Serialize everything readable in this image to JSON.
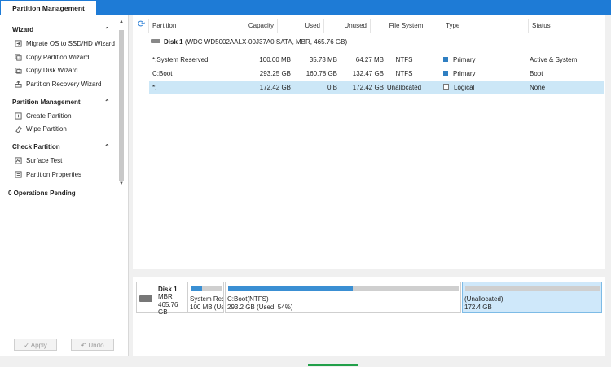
{
  "tab": {
    "label": "Partition Management"
  },
  "sidebar": {
    "sections": [
      {
        "title": "Wizard",
        "items": [
          "Migrate OS to SSD/HD Wizard",
          "Copy Partition Wizard",
          "Copy Disk Wizard",
          "Partition Recovery Wizard"
        ]
      },
      {
        "title": "Partition Management",
        "items": [
          "Create Partition",
          "Wipe Partition"
        ]
      },
      {
        "title": "Check Partition",
        "items": [
          "Surface Test",
          "Partition Properties"
        ]
      }
    ],
    "ops_pending": "0 Operations Pending",
    "apply_label": "✓ Apply",
    "undo_label": "↶ Undo"
  },
  "table": {
    "headers": [
      "Partition",
      "Capacity",
      "Used",
      "Unused",
      "File System",
      "Type",
      "Status"
    ],
    "disk_label": "Disk 1",
    "disk_detail": "(WDC WD5002AALX-00J37A0 SATA, MBR, 465.76 GB)",
    "rows": [
      {
        "partition": "*:System Reserved",
        "capacity": "100.00 MB",
        "used": "35.73 MB",
        "unused": "64.27 MB",
        "fs": "NTFS",
        "type": "Primary",
        "status": "Active & System"
      },
      {
        "partition": "C:Boot",
        "capacity": "293.25 GB",
        "used": "160.78 GB",
        "unused": "132.47 GB",
        "fs": "NTFS",
        "type": "Primary",
        "status": "Boot"
      },
      {
        "partition": "*:",
        "capacity": "172.42 GB",
        "used": "0 B",
        "unused": "172.42 GB",
        "fs": "Unallocated",
        "type": "Logical",
        "status": "None"
      }
    ]
  },
  "disk_map": {
    "name": "Disk 1",
    "scheme": "MBR",
    "size": "465.76 GB",
    "blocks": [
      {
        "l1": "System Rese",
        "l2": "100 MB (Us",
        "used_pct": 0.357
      },
      {
        "l1": "C:Boot(NTFS)",
        "l2": "293.2 GB (Used: 54%)",
        "used_pct": 0.54
      },
      {
        "l1": "(Unallocated)",
        "l2": "172.4 GB",
        "used_pct": 0
      }
    ]
  },
  "colors": {
    "accent": "#1e7bd6",
    "selected_row": "#cce7f7",
    "primary_type": "#2f7fc2",
    "usage_bar": "#3a8fd3"
  }
}
